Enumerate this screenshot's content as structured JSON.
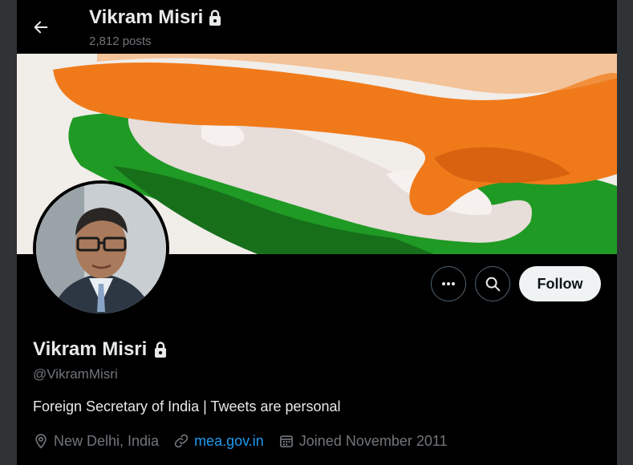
{
  "header": {
    "title": "Vikram Misri",
    "posts_count": "2,812 posts",
    "back_icon": "arrow-left-icon",
    "lock_icon": "lock-icon"
  },
  "profile": {
    "name": "Vikram Misri",
    "handle": "@VikramMisri",
    "bio": "Foreign Secretary of India | Tweets are personal",
    "location": "New Delhi, India",
    "website": "mea.gov.in",
    "joined": "Joined November 2011",
    "follow_label": "Follow"
  },
  "colors": {
    "background": "#000000",
    "text_primary": "#e7e9ea",
    "text_secondary": "#71767b",
    "link": "#1d9bf0",
    "follow_button_bg": "#eff3f4",
    "banner_orange": "#f07a1a",
    "banner_green": "#1f9a24"
  },
  "icons": {
    "more": "more-dots-icon",
    "search": "search-icon",
    "location": "location-pin-icon",
    "link": "link-icon",
    "calendar": "calendar-icon"
  }
}
